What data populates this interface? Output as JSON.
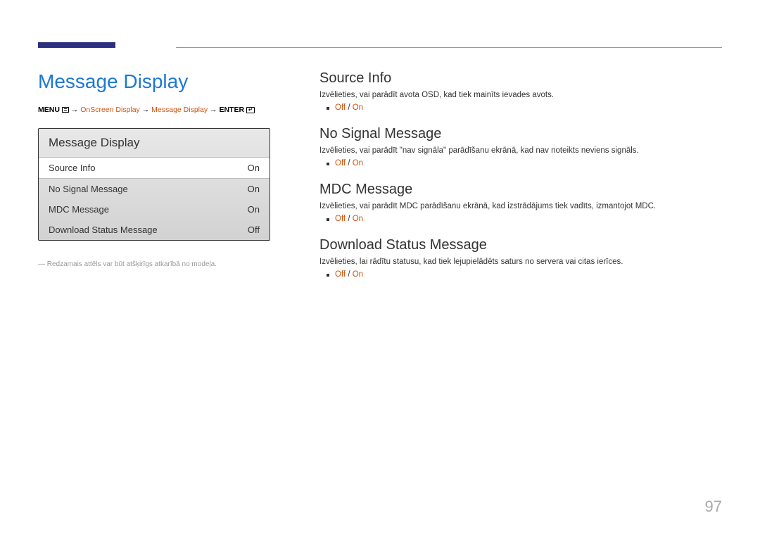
{
  "page_title": "Message Display",
  "breadcrumb": {
    "menu": "MENU",
    "path1": "OnScreen Display",
    "path2": "Message Display",
    "enter": "ENTER"
  },
  "menu_box": {
    "title": "Message Display",
    "rows": [
      {
        "label": "Source Info",
        "value": "On",
        "selected": true
      },
      {
        "label": "No Signal Message",
        "value": "On",
        "selected": false
      },
      {
        "label": "MDC Message",
        "value": "On",
        "selected": false
      },
      {
        "label": "Download Status Message",
        "value": "Off",
        "selected": false
      }
    ]
  },
  "footnote": "― Redzamais attēls var būt atšķirīgs atkarībā no modeļa.",
  "sections": [
    {
      "title": "Source Info",
      "desc": "Izvēlieties, vai parādīt avota OSD, kad tiek mainīts ievades avots.",
      "opt_off": "Off",
      "opt_on": "On"
    },
    {
      "title": "No Signal Message",
      "desc": "Izvēlieties, vai parādīt \"nav signāla\" parādīšanu ekrānā, kad nav noteikts neviens signāls.",
      "opt_off": "Off",
      "opt_on": "On"
    },
    {
      "title": "MDC Message",
      "desc": "Izvēlieties, vai parādīt MDC parādīšanu ekrānā, kad izstrādājums tiek vadīts, izmantojot MDC.",
      "opt_off": "Off",
      "opt_on": "On"
    },
    {
      "title": "Download Status Message",
      "desc": "Izvēlieties, lai rādītu statusu, kad tiek lejupielādēts saturs no servera vai citas ierīces.",
      "opt_off": "Off",
      "opt_on": "On"
    }
  ],
  "page_number": "97"
}
